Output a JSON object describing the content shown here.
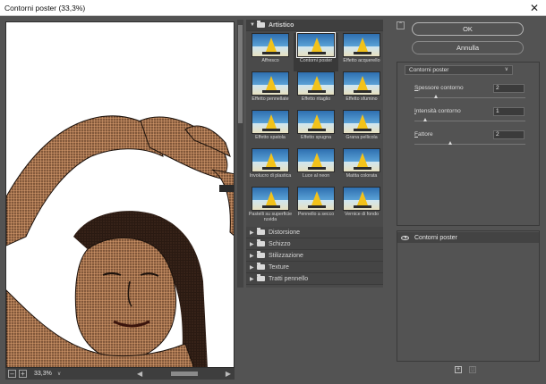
{
  "window": {
    "title": "Contorni poster (33,3%)",
    "close": "✕"
  },
  "preview": {
    "zoom": "33,3%",
    "zoom_out": "–",
    "zoom_in": "+"
  },
  "gallery": {
    "open_folder": "Artistico",
    "thumbnails": [
      {
        "label": "Affresco",
        "selected": false
      },
      {
        "label": "Contorni poster",
        "selected": true
      },
      {
        "label": "Effetto acquerello",
        "selected": false
      },
      {
        "label": "Effetto pennellate",
        "selected": false
      },
      {
        "label": "Effetto ritaglio",
        "selected": false
      },
      {
        "label": "Effetto sfumino",
        "selected": false
      },
      {
        "label": "Effetto spatola",
        "selected": false
      },
      {
        "label": "Effetto spugna",
        "selected": false
      },
      {
        "label": "Grana pellicola",
        "selected": false
      },
      {
        "label": "Involucro di plastica",
        "selected": false
      },
      {
        "label": "Luce al neon",
        "selected": false
      },
      {
        "label": "Matita colorata",
        "selected": false
      },
      {
        "label": "Pastelli su superficie ruvida",
        "selected": false
      },
      {
        "label": "Pennello a secco",
        "selected": false
      },
      {
        "label": "Vernice di fondo",
        "selected": false
      }
    ],
    "folders": [
      "Distorsione",
      "Schizzo",
      "Stilizzazione",
      "Texture",
      "Tratti pennello"
    ]
  },
  "buttons": {
    "ok": "OK",
    "cancel": "Annulla"
  },
  "settings": {
    "filter": "Contorni poster",
    "params": [
      {
        "label": "Spessore contorno",
        "access_key": "S",
        "rest": "pessore contorno",
        "value": "2",
        "level": 0.2
      },
      {
        "label": "Intensità contorno",
        "access_key": "I",
        "rest": "ntensità contorno",
        "value": "1",
        "level": 0.1
      },
      {
        "label": "Fattore",
        "access_key": "F",
        "rest": "attore",
        "value": "2",
        "level": 0.33
      }
    ]
  },
  "layers": {
    "items": [
      {
        "name": "Contorni poster"
      }
    ]
  },
  "colors": {
    "panel": "#535353",
    "dark": "#3e3e3e",
    "text": "#d6d6d6",
    "accent_sail": "#f2c21a",
    "sky": "#2e6fb0"
  }
}
